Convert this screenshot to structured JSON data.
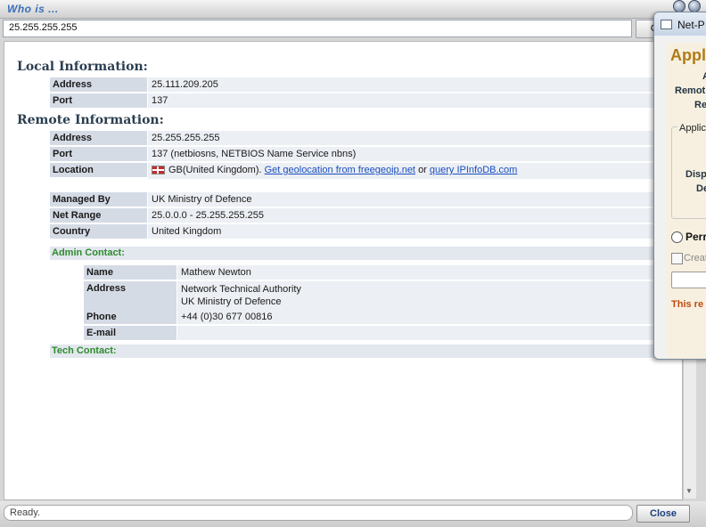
{
  "window": {
    "title": "Who is ..."
  },
  "address_bar": {
    "value": "25.255.255.255",
    "go_label": "G"
  },
  "local": {
    "title": "Local Information:",
    "rows": [
      {
        "label": "Address",
        "value": "25.111.209.205"
      },
      {
        "label": "Port",
        "value": "137"
      }
    ]
  },
  "remote": {
    "title": "Remote Information:",
    "address": {
      "label": "Address",
      "value": "25.255.255.255"
    },
    "port": {
      "label": "Port",
      "value": "137 (netbiosns, NETBIOS Name Service nbns)"
    },
    "location": {
      "label": "Location",
      "country": "GB(United Kingdom).",
      "link1": "Get geolocation from freegeoip.net",
      "or": "or",
      "link2": "query IPInfoDB.com",
      "flag_icon": "uk-flag-icon"
    },
    "registry": [
      {
        "label": "Managed By",
        "value": "UK Ministry of Defence"
      },
      {
        "label": "Net Range",
        "value": "25.0.0.0 - 25.255.255.255"
      },
      {
        "label": "Country",
        "value": "United Kingdom"
      }
    ]
  },
  "admin_contact": {
    "title": "Admin Contact:",
    "name": {
      "label": "Name",
      "value": "Mathew Newton"
    },
    "address": {
      "label": "Address",
      "line1": "Network Technical Authority",
      "line2": "UK Ministry of Defence"
    },
    "phone": {
      "label": "Phone",
      "value": "+44 (0)30 677 00816"
    },
    "email": {
      "label": "E-mail",
      "value": ""
    }
  },
  "tech_contact": {
    "title": "Tech Contact:"
  },
  "status": {
    "text": "Ready."
  },
  "buttons": {
    "close": "Close"
  },
  "dialog": {
    "title": "Net-P",
    "heading": "Appli",
    "labels": [
      "A",
      "Remot",
      "Re"
    ],
    "group_label": "Applica",
    "group_labels": [
      "Disp",
      "De"
    ],
    "radio_label": "Perr",
    "checkbox_label": "Creat",
    "warning": "This re"
  },
  "colors": {
    "section_title": "#2b3e50",
    "contact_title": "#2e8b2e",
    "link": "#1a4fbf",
    "dialog_heading": "#b07a16",
    "warning": "#c04b10"
  }
}
